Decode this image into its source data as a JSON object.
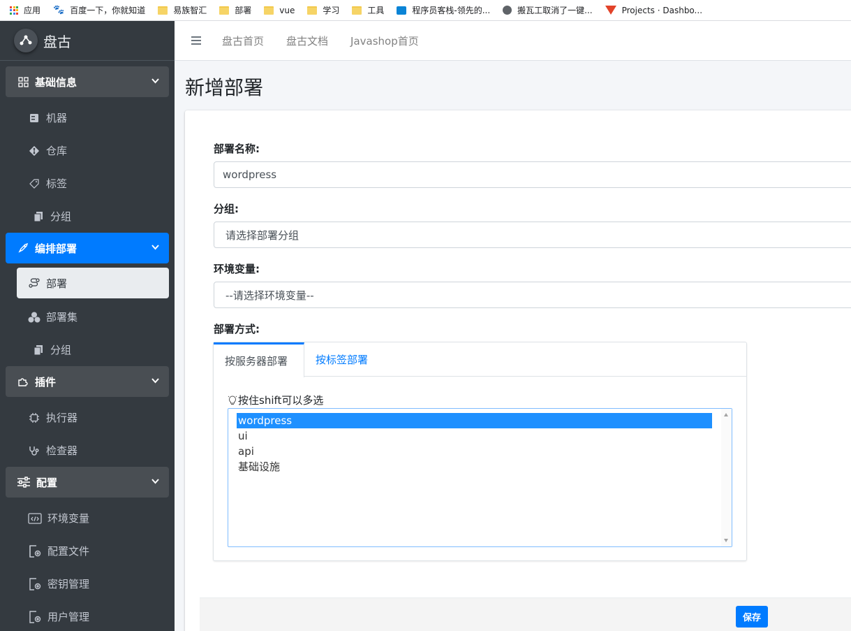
{
  "bookmarks": [
    {
      "label": "应用",
      "icon": "apps-grid-icon"
    },
    {
      "label": "百度一下，你就知道",
      "icon": "baidu-paw-icon"
    },
    {
      "label": "易族智汇",
      "icon": "folder-icon"
    },
    {
      "label": "部署",
      "icon": "folder-icon"
    },
    {
      "label": "vue",
      "icon": "folder-icon"
    },
    {
      "label": "学习",
      "icon": "folder-icon"
    },
    {
      "label": "工具",
      "icon": "folder-icon"
    },
    {
      "label": "程序员客栈-领先的...",
      "icon": "terminal-icon"
    },
    {
      "label": "搬瓦工取消了一键...",
      "icon": "globe-icon"
    },
    {
      "label": "Projects · Dashbo...",
      "icon": "gitlab-fox-icon"
    }
  ],
  "brand": {
    "name": "盘古"
  },
  "sidebar": {
    "groups": [
      {
        "label": "基础信息",
        "icon": "grid-icon",
        "items": [
          {
            "label": "机器",
            "icon": "server-icon"
          },
          {
            "label": "仓库",
            "icon": "git-diamond-icon"
          },
          {
            "label": "标签",
            "icon": "tag-icon"
          },
          {
            "label": "分组",
            "icon": "copy-icon"
          }
        ]
      },
      {
        "label": "编排部署",
        "icon": "rocket-icon",
        "items": [
          {
            "label": "部署",
            "icon": "route-icon"
          },
          {
            "label": "部署集",
            "icon": "cubes-icon"
          },
          {
            "label": "分组",
            "icon": "copy-icon"
          }
        ]
      },
      {
        "label": "插件",
        "icon": "puzzle-icon",
        "items": [
          {
            "label": "执行器",
            "icon": "chip-icon"
          },
          {
            "label": "检查器",
            "icon": "stethoscope-icon"
          }
        ]
      },
      {
        "label": "配置",
        "icon": "sliders-icon",
        "items": [
          {
            "label": "环境变量",
            "icon": "code-window-icon"
          },
          {
            "label": "配置文件",
            "icon": "file-gear-icon"
          },
          {
            "label": "密钥管理",
            "icon": "file-gear-icon"
          },
          {
            "label": "用户管理",
            "icon": "file-gear-icon"
          }
        ]
      }
    ]
  },
  "topnav": {
    "links": [
      "盘古首页",
      "盘古文档",
      "Javashop首页"
    ]
  },
  "page": {
    "title": "新增部署"
  },
  "form": {
    "name_label": "部署名称:",
    "name_value": "wordpress",
    "group_label": "分组:",
    "group_value": "请选择部署分组",
    "env_label": "环境变量:",
    "env_value": "--请选择环境变量--",
    "method_label": "部署方式:",
    "tabs": [
      "按服务器部署",
      "按标签部署"
    ],
    "hint": "按住shift可以多选",
    "servers": [
      "wordpress",
      "ui",
      "api",
      "基础设施"
    ],
    "selected_server": "wordpress"
  },
  "footer": {
    "save_label": "保存"
  },
  "colors": {
    "primary": "#007bff",
    "sidebar": "#343a40",
    "selection": "#1e90ff"
  }
}
